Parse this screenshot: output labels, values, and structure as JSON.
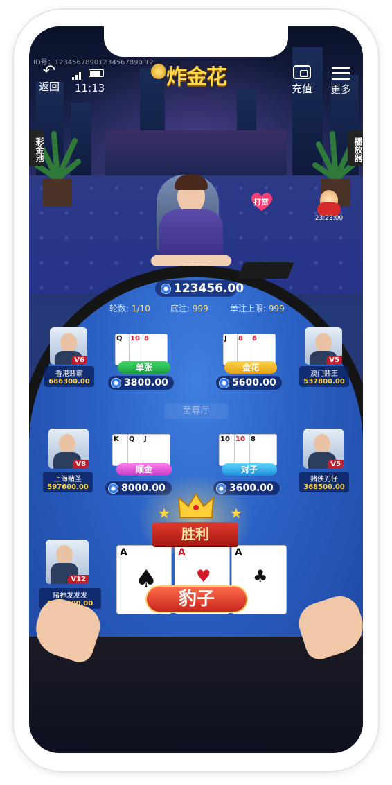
{
  "status_bar": {
    "device_id": "ID号：12345678901234567890 12",
    "time": "11:13"
  },
  "header": {
    "back_label": "返回",
    "logo_text": "炸金花",
    "recharge_label": "充值",
    "more_label": "更多"
  },
  "side": {
    "jackpot_label": "彩金池",
    "player_label": "播放器"
  },
  "dealer": {
    "tip_label": "打赏",
    "mascot_time": "23:23:00"
  },
  "table": {
    "pot": "123456.00",
    "round_label": "轮数:",
    "round_value": "1/10",
    "base_label": "底注:",
    "base_value": "999",
    "limit_label": "单注上限:",
    "limit_value": "999",
    "hall_name": "至尊厅"
  },
  "players": [
    {
      "name": "香港赌霸",
      "score": "686300.00",
      "vip": "V6"
    },
    {
      "name": "澳门赌王",
      "score": "537800.00",
      "vip": "V5"
    },
    {
      "name": "上海赌圣",
      "score": "597600.00",
      "vip": "V8"
    },
    {
      "name": "赌侠刀仔",
      "score": "368500.00",
      "vip": "V5"
    },
    {
      "name": "赌神发发发",
      "score": "6359600.00",
      "vip": "V12"
    }
  ],
  "hands": [
    {
      "type": "单张",
      "bet": "3800.00",
      "cards": [
        "Q",
        "10",
        "8"
      ]
    },
    {
      "type": "金花",
      "bet": "5600.00",
      "cards": [
        "J",
        "8",
        "6"
      ]
    },
    {
      "type": "顺金",
      "bet": "8000.00",
      "cards": [
        "K",
        "Q",
        "J"
      ]
    },
    {
      "type": "对子",
      "bet": "3600.00",
      "cards": [
        "10",
        "10",
        "8"
      ]
    }
  ],
  "result": {
    "banner": "胜利",
    "hand_type": "豹子",
    "cards": [
      "A",
      "A",
      "A"
    ]
  },
  "colors": {
    "felt": "#2a5fc2",
    "gold": "#ffd24a",
    "red_tag": "#c21d2b"
  }
}
